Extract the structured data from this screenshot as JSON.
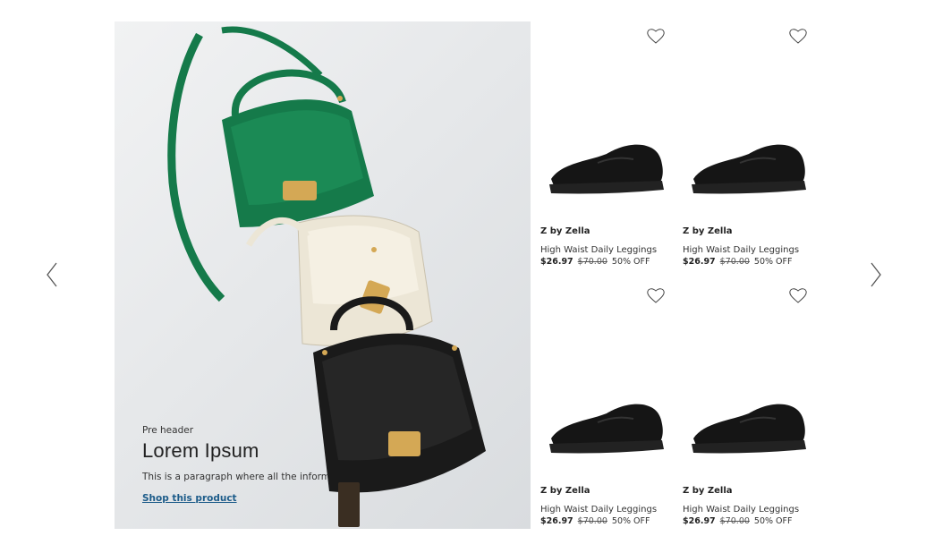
{
  "hero": {
    "pre_header": "Pre header",
    "title": "Lorem Ipsum",
    "paragraph": "This is a paragraph where all the information of the product is displayed",
    "link_label": "Shop this product"
  },
  "products": [
    {
      "brand": "Z by Zella",
      "name": "High Waist Daily Leggings",
      "sale_price": "$26.97",
      "original_price": "$70.00",
      "discount": "50% OFF"
    },
    {
      "brand": "Z by Zella",
      "name": "High Waist Daily Leggings",
      "sale_price": "$26.97",
      "original_price": "$70.00",
      "discount": "50% OFF"
    },
    {
      "brand": "Z by Zella",
      "name": "High Waist Daily Leggings",
      "sale_price": "$26.97",
      "original_price": "$70.00",
      "discount": "50% OFF"
    },
    {
      "brand": "Z by Zella",
      "name": "High Waist Daily Leggings",
      "sale_price": "$26.97",
      "original_price": "$70.00",
      "discount": "50% OFF"
    }
  ],
  "icons": {
    "prev": "chevron-left-icon",
    "next": "chevron-right-icon",
    "wishlist": "heart-icon"
  },
  "colors": {
    "link": "#1d5c8a",
    "bag_green": "#157a4a",
    "bag_cream": "#ece6d6",
    "bag_black": "#1a1a1a",
    "hardware_gold": "#d4a855"
  }
}
